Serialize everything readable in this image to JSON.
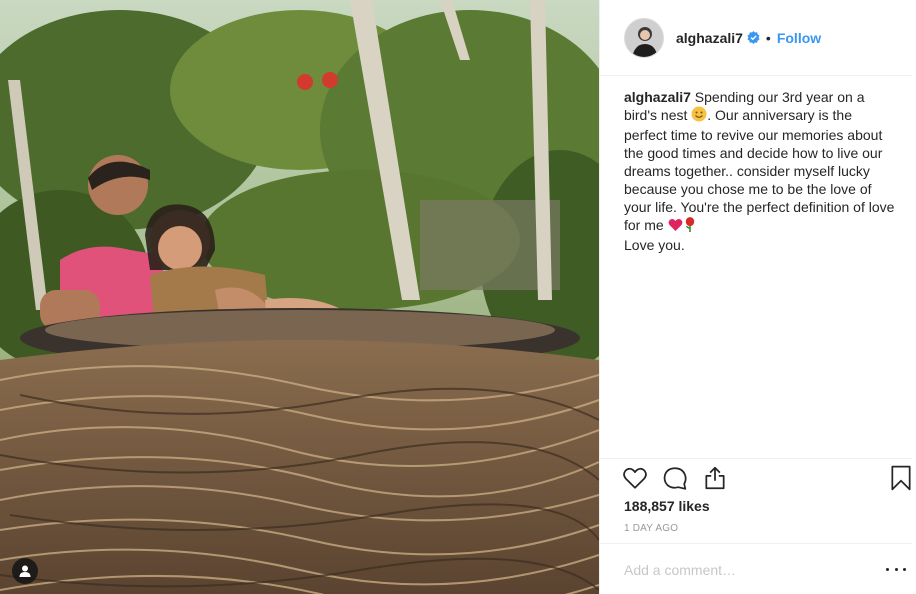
{
  "post": {
    "username": "alghazali7",
    "dot": "•",
    "follow_label": "Follow",
    "caption_user": "alghazali7",
    "caption_lines": [
      " Spending our 3rd year on a",
      "bird's nest ",
      ". Our anniversary is the",
      "perfect time to revive our memories about",
      "the good times and decide how to live our",
      "dreams together.. consider myself lucky",
      "because you chose me to be the love of",
      "your life. You're the perfect definition of love",
      "for me ",
      "Love you."
    ],
    "likes": "188,857 likes",
    "time_ago": "1 DAY AGO",
    "comment_placeholder": "Add a comment…"
  },
  "icons": {
    "verified": "verified-badge-icon",
    "like": "heart-icon",
    "comment": "comment-icon",
    "share": "share-icon",
    "save": "bookmark-icon",
    "more": "more-options-icon",
    "tagged": "user-icon"
  },
  "colors": {
    "link": "#3897f0",
    "text": "#262626",
    "muted": "#999999",
    "border": "#efefef"
  }
}
